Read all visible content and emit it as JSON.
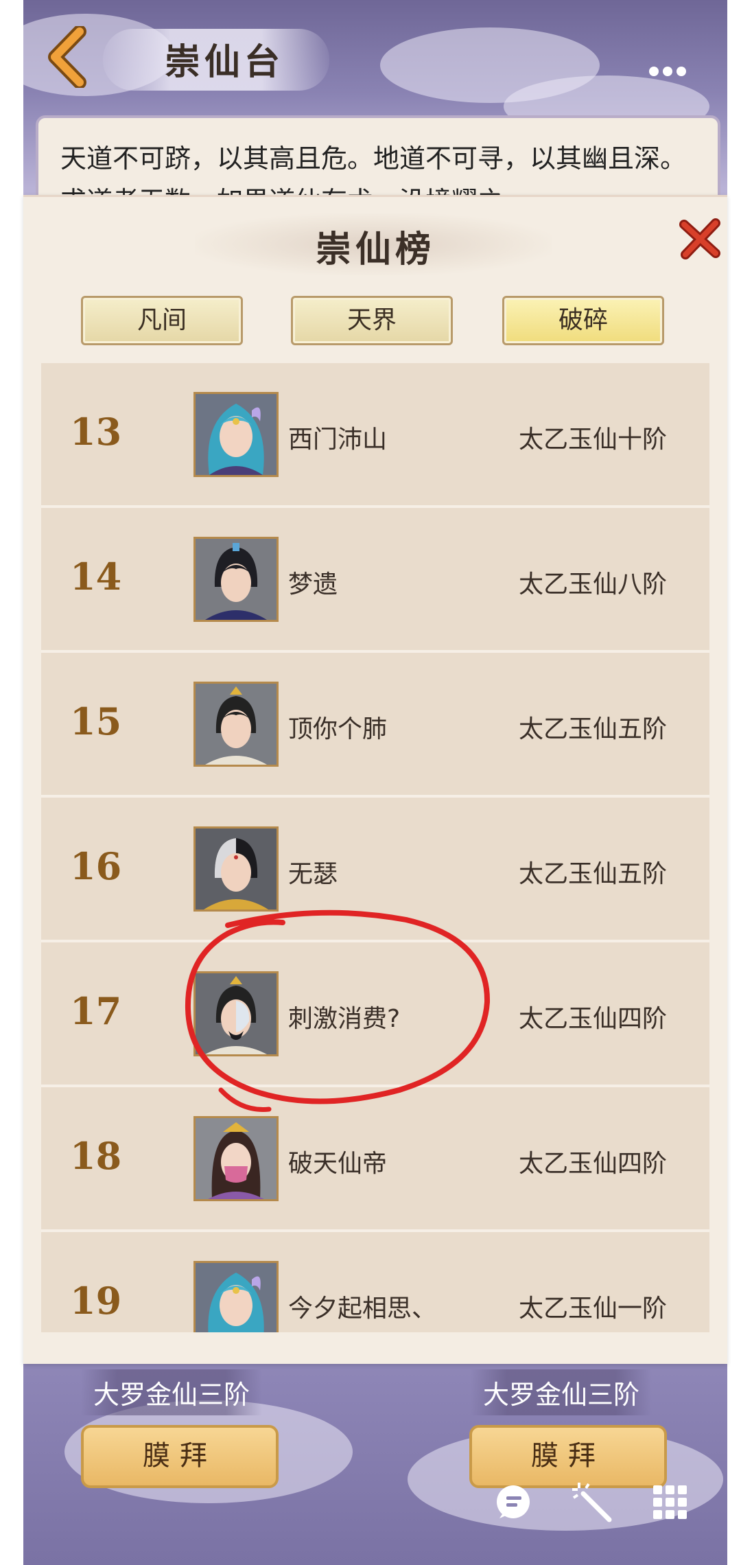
{
  "header": {
    "title": "崇仙台",
    "intro_text": "天道不可跻，以其高且危。地道不可寻，以其幽且深。求道者无数，如果道仙有术，没境耀之"
  },
  "modal": {
    "title": "崇仙榜",
    "tabs": [
      {
        "label": "凡间",
        "active": false
      },
      {
        "label": "天界",
        "active": false
      },
      {
        "label": "破碎",
        "active": true
      }
    ],
    "ranks": [
      {
        "rank": "13",
        "name": "西门沛山",
        "level": "太乙玉仙十阶"
      },
      {
        "rank": "14",
        "name": "梦遗",
        "level": "太乙玉仙八阶"
      },
      {
        "rank": "15",
        "name": "顶你个肺",
        "level": "太乙玉仙五阶"
      },
      {
        "rank": "16",
        "name": "无瑟",
        "level": "太乙玉仙五阶"
      },
      {
        "rank": "17",
        "name": "刺激消费?",
        "level": "太乙玉仙四阶"
      },
      {
        "rank": "18",
        "name": "破天仙帝",
        "level": "太乙玉仙四阶"
      },
      {
        "rank": "19",
        "name": "今夕起相思、",
        "level": "太乙玉仙一阶"
      }
    ]
  },
  "bottom": {
    "left_level": "大罗金仙三阶",
    "right_level": "大罗金仙三阶",
    "left_button": "膜拜",
    "right_button": "膜拜"
  },
  "colors": {
    "rank_number": "#8a5a1c",
    "annotation": "#e02424",
    "tab_active": "#f0dc7c"
  },
  "icons": [
    "back-arrow-icon",
    "more-icon",
    "close-icon",
    "chat-icon",
    "magic-wand-icon",
    "grid-menu-icon"
  ]
}
